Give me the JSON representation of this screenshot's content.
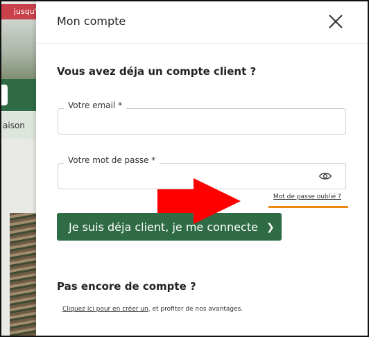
{
  "background_page": {
    "promo_text": "jusqu'",
    "nav_text": "aison"
  },
  "modal": {
    "title": "Mon compte",
    "close_icon": "close-icon",
    "existing_title": "Vous avez déja un compte client ?",
    "email_label": "Votre email *",
    "email_value": "",
    "password_label": "Votre mot de passe *",
    "password_value": "",
    "show_password_icon": "eye-icon",
    "forgot_link": "Mot de passe oublié ?",
    "login_button": "Je suis déja client, je me connecte",
    "login_chevron": "❯",
    "new_title": "Pas encore de compte ?",
    "create_link": "Cliquez ici pour en créer un",
    "create_rest": ", et profiter de nos avantages."
  },
  "annotations": {
    "arrow_color": "#ff0000",
    "highlight_color": "#ee8a10"
  },
  "colors": {
    "brand_green": "#2f6b45",
    "promo_red": "#c8414b"
  }
}
